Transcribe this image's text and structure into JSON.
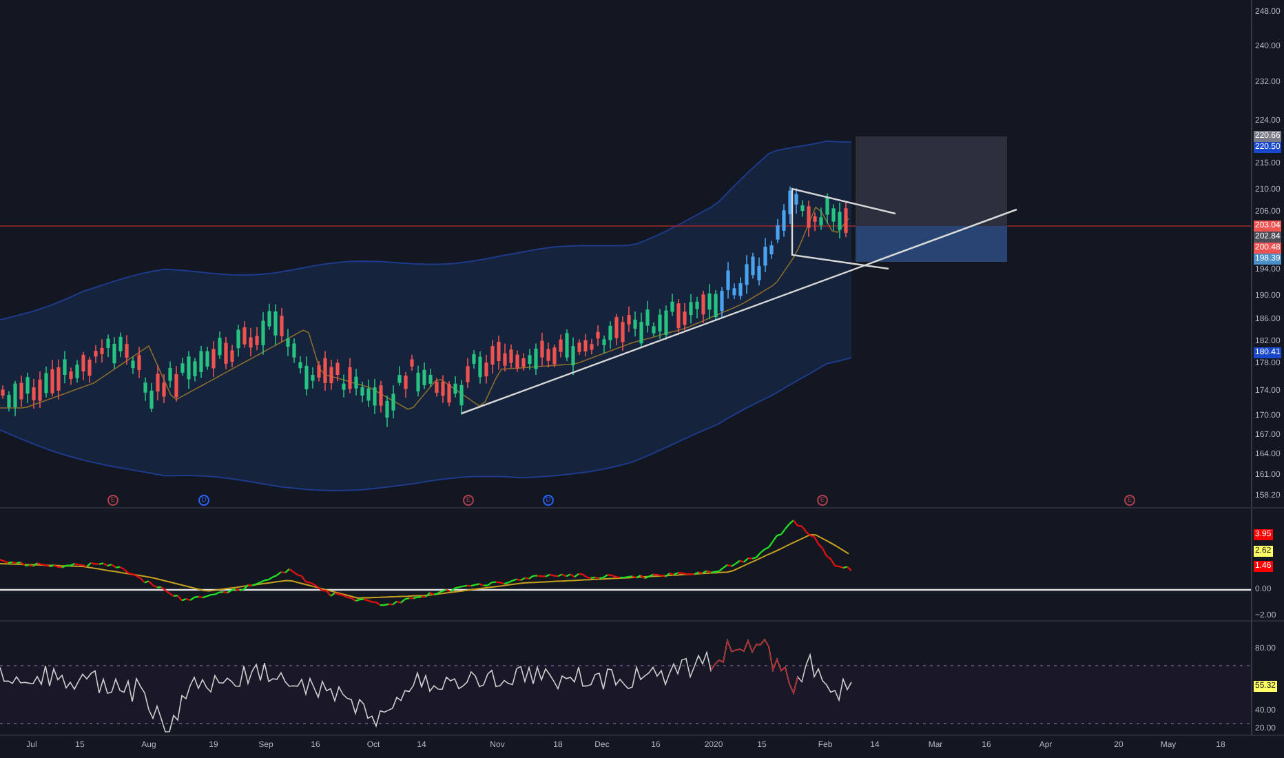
{
  "price_axis": [
    {
      "text": "248.00",
      "kind": "tick"
    },
    {
      "text": "240.00",
      "kind": "tick"
    },
    {
      "text": "232.00",
      "kind": "tick"
    },
    {
      "text": "224.00",
      "kind": "tick"
    },
    {
      "text": "220.66",
      "kind": "badge",
      "color": "#787b86"
    },
    {
      "text": "220.50",
      "kind": "badge",
      "color": "#1848cc"
    },
    {
      "text": "215.00",
      "kind": "tick"
    },
    {
      "text": "210.00",
      "kind": "tick"
    },
    {
      "text": "206.00",
      "kind": "tick"
    },
    {
      "text": "203.04",
      "kind": "badge",
      "color": "#ef5350"
    },
    {
      "text": "202.84",
      "kind": "badge",
      "color": "#4a4d57"
    },
    {
      "text": "200.48",
      "kind": "badge",
      "color": "#ef5350"
    },
    {
      "text": "198.39",
      "kind": "badge",
      "color": "#4a8fc8"
    },
    {
      "text": "194.00",
      "kind": "tick"
    },
    {
      "text": "190.00",
      "kind": "tick"
    },
    {
      "text": "186.00",
      "kind": "tick"
    },
    {
      "text": "182.00",
      "kind": "tick"
    },
    {
      "text": "180.41",
      "kind": "badge",
      "color": "#1848cc"
    },
    {
      "text": "178.00",
      "kind": "tick"
    },
    {
      "text": "174.00",
      "kind": "tick"
    },
    {
      "text": "170.00",
      "kind": "tick"
    },
    {
      "text": "167.00",
      "kind": "tick"
    },
    {
      "text": "164.00",
      "kind": "tick"
    },
    {
      "text": "161.00",
      "kind": "tick"
    },
    {
      "text": "158.20",
      "kind": "tick"
    }
  ],
  "event_markers": [
    {
      "text": "E",
      "kind": "earnings"
    },
    {
      "text": "D",
      "kind": "dividend"
    },
    {
      "text": "E",
      "kind": "earnings"
    },
    {
      "text": "D",
      "kind": "dividend"
    },
    {
      "text": "E",
      "kind": "earnings"
    },
    {
      "text": "E",
      "kind": "earnings"
    }
  ],
  "macd_axis": [
    {
      "text": "3.95",
      "kind": "badge",
      "color": "#ff0000"
    },
    {
      "text": "2.62",
      "kind": "badge-light",
      "color": "#ffff66"
    },
    {
      "text": "1.46",
      "kind": "badge",
      "color": "#ff0000"
    },
    {
      "text": "0.00",
      "kind": "tick"
    },
    {
      "text": "−2.00",
      "kind": "tick"
    }
  ],
  "rsi_axis": [
    {
      "text": "80.00",
      "kind": "tick"
    },
    {
      "text": "55.32",
      "kind": "badge-light",
      "color": "#ffff66"
    },
    {
      "text": "40.00",
      "kind": "tick"
    },
    {
      "text": "20.00",
      "kind": "tick"
    }
  ],
  "time_axis": [
    "Jul",
    "15",
    "Aug",
    "19",
    "Sep",
    "16",
    "Oct",
    "14",
    "Nov",
    "18",
    "Dec",
    "16",
    "2020",
    "15",
    "Feb",
    "14",
    "Mar",
    "16",
    "Apr",
    "20",
    "May",
    "18"
  ]
}
